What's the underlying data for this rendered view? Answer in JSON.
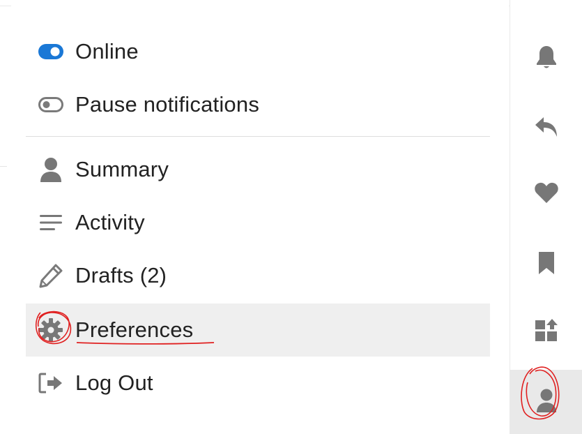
{
  "menu": {
    "status_items": [
      {
        "label": "Online",
        "icon": "toggle-on-icon"
      },
      {
        "label": "Pause notifications",
        "icon": "toggle-off-icon"
      }
    ],
    "items": [
      {
        "label": "Summary",
        "icon": "user-icon"
      },
      {
        "label": "Activity",
        "icon": "list-icon"
      },
      {
        "label": "Drafts (2)",
        "icon": "pencil-icon"
      },
      {
        "label": "Preferences",
        "icon": "gear-icon",
        "highlighted": true
      },
      {
        "label": "Log Out",
        "icon": "sign-out-icon"
      }
    ]
  },
  "rail": {
    "buttons": [
      {
        "icon": "bell-icon"
      },
      {
        "icon": "reply-icon"
      },
      {
        "icon": "heart-icon"
      },
      {
        "icon": "bookmark-icon"
      },
      {
        "icon": "pending-review-icon"
      },
      {
        "icon": "user-icon",
        "active": true
      }
    ]
  },
  "colors": {
    "toggle_on": "#1a78d6",
    "icon_gray": "#777777",
    "text": "#222222",
    "hover_bg": "#efefef",
    "annotation_red": "#e02020"
  }
}
